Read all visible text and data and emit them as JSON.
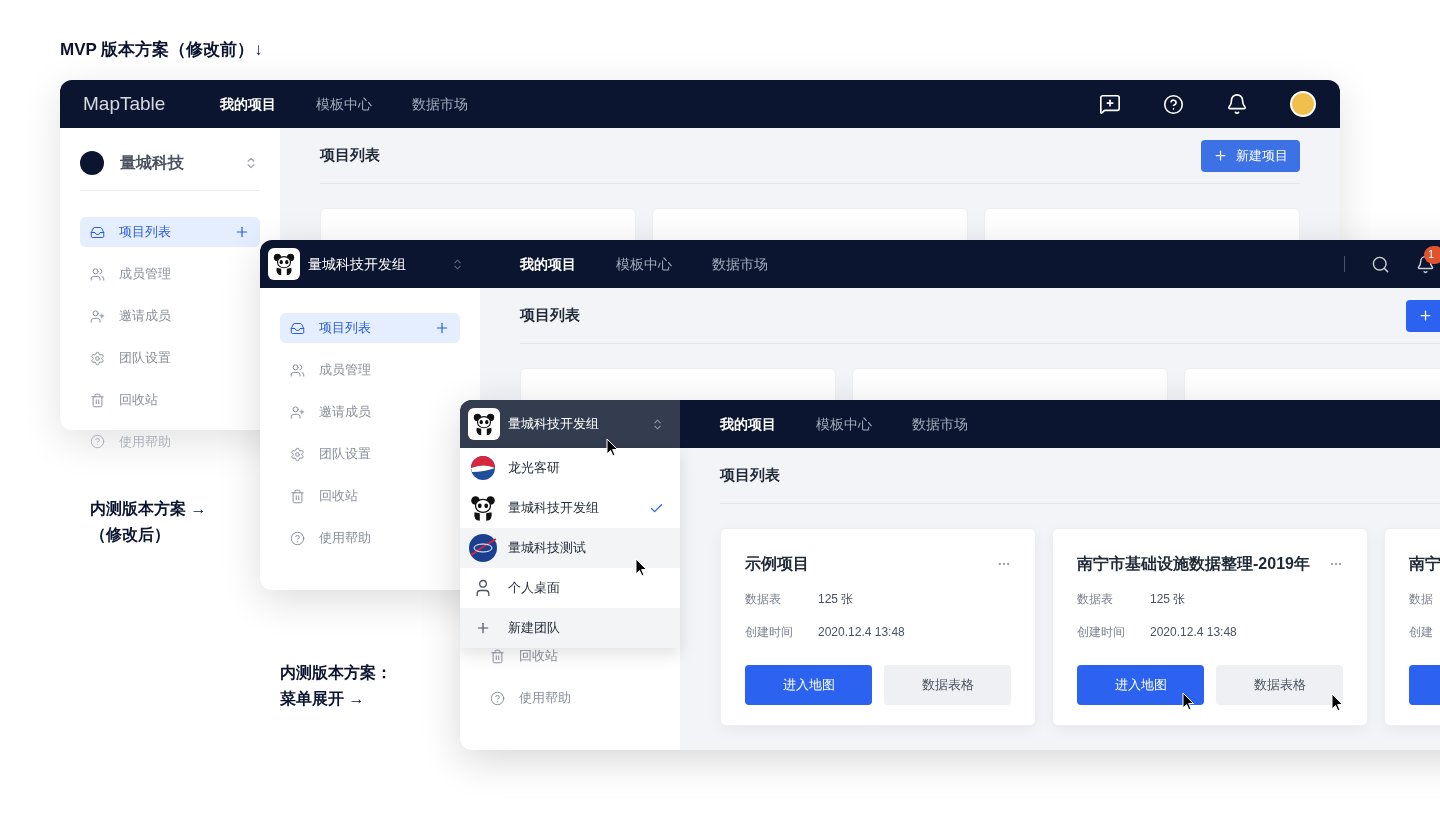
{
  "captions": {
    "mvp": "MVP 版本方案（修改前）↓",
    "beta": [
      "内测版本方案 →",
      "（修改后）"
    ],
    "menu": [
      "内测版本方案：",
      "菜单展开 →"
    ]
  },
  "mvp_window": {
    "logo": "MapTable",
    "nav": [
      {
        "label": "我的项目",
        "selected": true
      },
      {
        "label": "模板中心",
        "selected": false
      },
      {
        "label": "数据市场",
        "selected": false
      }
    ],
    "team": "量城科技",
    "sidebar": [
      {
        "label": "项目列表",
        "selected": true
      },
      {
        "label": "成员管理",
        "selected": false
      },
      {
        "label": "邀请成员",
        "selected": false
      },
      {
        "label": "团队设置",
        "selected": false
      },
      {
        "label": "回收站",
        "selected": false
      }
    ],
    "faded_item": {
      "label": "使用帮助"
    },
    "title": "项目列表",
    "new_button": "新建项目"
  },
  "beta_window": {
    "team": "量城科技开发组",
    "nav": [
      {
        "label": "我的项目",
        "selected": true
      },
      {
        "label": "模板中心",
        "selected": false
      },
      {
        "label": "数据市场",
        "selected": false
      }
    ],
    "notification_badge": "1",
    "sidebar": [
      {
        "label": "项目列表",
        "selected": true
      },
      {
        "label": "成员管理",
        "selected": false
      },
      {
        "label": "邀请成员",
        "selected": false
      },
      {
        "label": "团队设置",
        "selected": false
      },
      {
        "label": "回收站",
        "selected": false
      },
      {
        "label": "使用帮助",
        "selected": false
      }
    ],
    "title": "项目列表"
  },
  "menu_window": {
    "team": "量城科技开发组",
    "nav": [
      {
        "label": "我的项目",
        "selected": true
      },
      {
        "label": "模板中心",
        "selected": false
      },
      {
        "label": "数据市场",
        "selected": false
      }
    ],
    "team_menu": [
      {
        "kind": "team",
        "label": "龙光客研",
        "selected": false,
        "highlighted": false
      },
      {
        "kind": "team",
        "label": "量城科技开发组",
        "selected": true,
        "highlighted": false
      },
      {
        "kind": "team",
        "label": "量城科技测试",
        "selected": false,
        "highlighted": true
      },
      {
        "kind": "personal",
        "label": "个人桌面",
        "selected": false,
        "highlighted": false
      },
      {
        "kind": "action",
        "label": "新建团队",
        "selected": false,
        "highlighted": true
      }
    ],
    "sidebar": [
      {
        "label": "回收站",
        "selected": false
      },
      {
        "label": "使用帮助",
        "selected": false
      }
    ],
    "title": "项目列表",
    "cards": [
      {
        "title": "示例项目",
        "rows": [
          {
            "label": "数据表",
            "value": "125 张"
          },
          {
            "label": "创建时间",
            "value": "2020.12.4 13:48"
          }
        ],
        "buttons": [
          {
            "kind": "primary",
            "label": "进入地图"
          },
          {
            "kind": "secondary",
            "label": "数据表格"
          }
        ]
      },
      {
        "title": "南宁市基础设施数据整理-2019年",
        "rows": [
          {
            "label": "数据表",
            "value": "125 张"
          },
          {
            "label": "创建时间",
            "value": "2020.12.4 13:48"
          }
        ],
        "buttons": [
          {
            "kind": "primary",
            "label": "进入地图"
          },
          {
            "kind": "secondary",
            "label": "数据表格"
          }
        ]
      },
      {
        "title": "南宁",
        "rows": [
          {
            "label": "数据"
          },
          {
            "label": "创建"
          }
        ],
        "buttons": [
          {
            "kind": "primary"
          }
        ]
      }
    ]
  }
}
